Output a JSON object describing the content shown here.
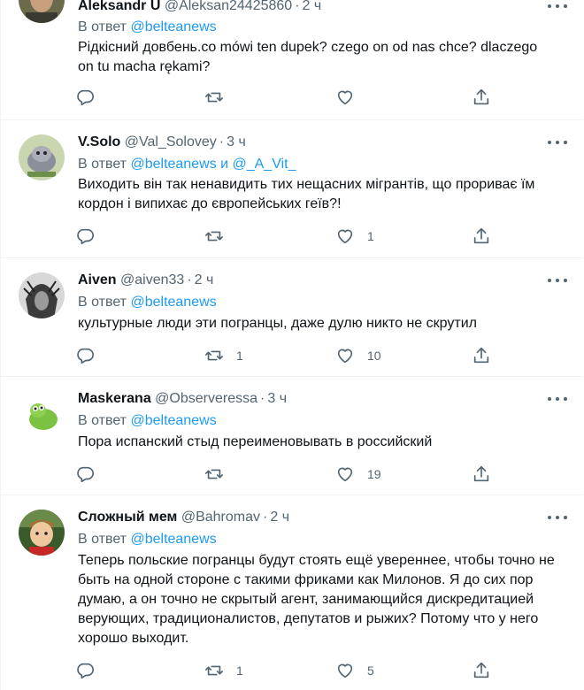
{
  "reply_prefix": "В ответ",
  "tweets": [
    {
      "name": "Aleksandr U",
      "handle": "@Aleksan24425860",
      "time": "2 ч",
      "reply_to": "@belteanews",
      "text": "Рідкісний довбень.co mówi ten dupek?  czego on od nas chce?  dlaczego\non tu macha rękami?",
      "retweets": "",
      "likes": ""
    },
    {
      "name": "V.Solo",
      "handle": "@Val_Solovey",
      "time": "3 ч",
      "reply_to": "@belteanews и @_A_Vit_",
      "text": "Виходить він так ненавидить тих нещасних мігрантів, що прориває їм\nкордон і випихає до європейських геїв?!",
      "retweets": "",
      "likes": "1"
    },
    {
      "name": "Aiven",
      "handle": "@aiven33",
      "time": "2 ч",
      "reply_to": "@belteanews",
      "text": "культурные люди эти погранцы, даже дулю никто не скрутил",
      "retweets": "1",
      "likes": "10"
    },
    {
      "name": "Maskerana",
      "handle": "@Observeressa",
      "time": "3 ч",
      "reply_to": "@belteanews",
      "text": "Пора испанский стыд переименовывать в российский",
      "retweets": "",
      "likes": "19"
    },
    {
      "name": "Сложный мем",
      "handle": "@Bahromav",
      "time": "2 ч",
      "reply_to": "@belteanews",
      "text": "Теперь польские погранцы будут стоять ещё увереннее,  чтобы точно не\nбыть на одной стороне с такими фриками как Милонов. Я до сих пор\nдумаю, а он точно не скрытый агент, занимающийся дискредитацией\nверующих, традиционалистов, депутатов и рыжих? Потому что у него\nхорошо выходит.",
      "retweets": "1",
      "likes": "5"
    }
  ],
  "colors": {
    "text": "#0f1419",
    "secondary": "#536471",
    "link": "#1d9bf0",
    "divider": "#eff3f4"
  },
  "icons": [
    "reply-icon",
    "retweet-icon",
    "like-icon",
    "share-icon",
    "more-icon"
  ]
}
